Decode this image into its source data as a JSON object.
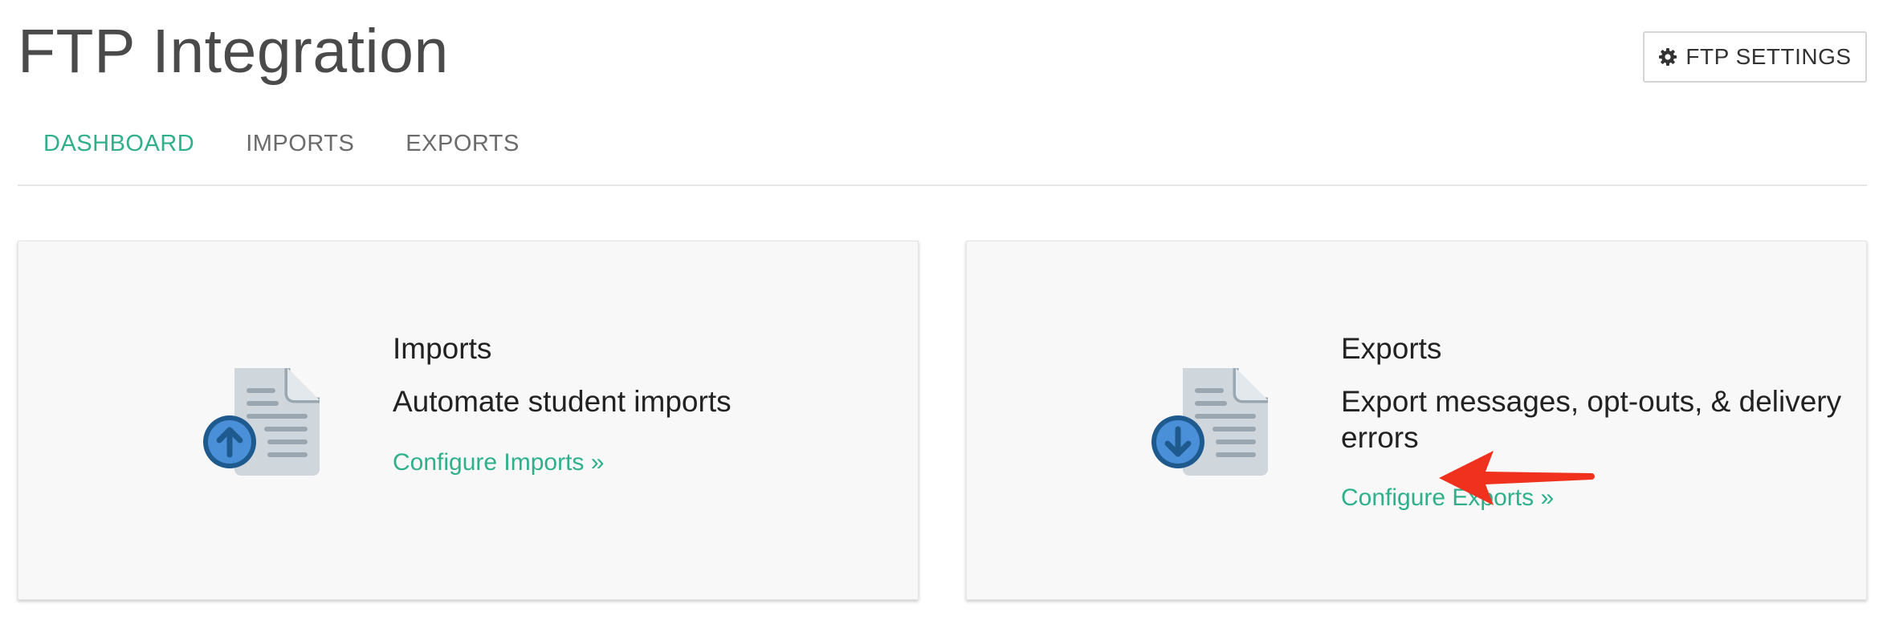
{
  "header": {
    "title": "FTP Integration",
    "settings_button": {
      "label": "FTP SETTINGS",
      "icon": "gear-icon"
    }
  },
  "tabs": [
    {
      "label": "DASHBOARD",
      "active": true
    },
    {
      "label": "IMPORTS",
      "active": false
    },
    {
      "label": "EXPORTS",
      "active": false
    }
  ],
  "cards": {
    "imports": {
      "icon": "document-upload-icon",
      "heading": "Imports",
      "description": "Automate student imports",
      "link": "Configure Imports »"
    },
    "exports": {
      "icon": "document-download-icon",
      "heading": "Exports",
      "description": "Export messages, opt-outs, & delivery errors",
      "link": "Configure Exports »"
    }
  },
  "annotation": {
    "icon": "red-arrow-icon"
  },
  "colors": {
    "accent": "#2fb08b",
    "title_text": "#4a4a4a",
    "card_bg": "#f8f8f8",
    "icon_blue": "#4a90d9",
    "icon_blue_dark": "#1f5a8e",
    "document_gray": "#cfd6dc",
    "annotation_red": "#f0311e"
  }
}
